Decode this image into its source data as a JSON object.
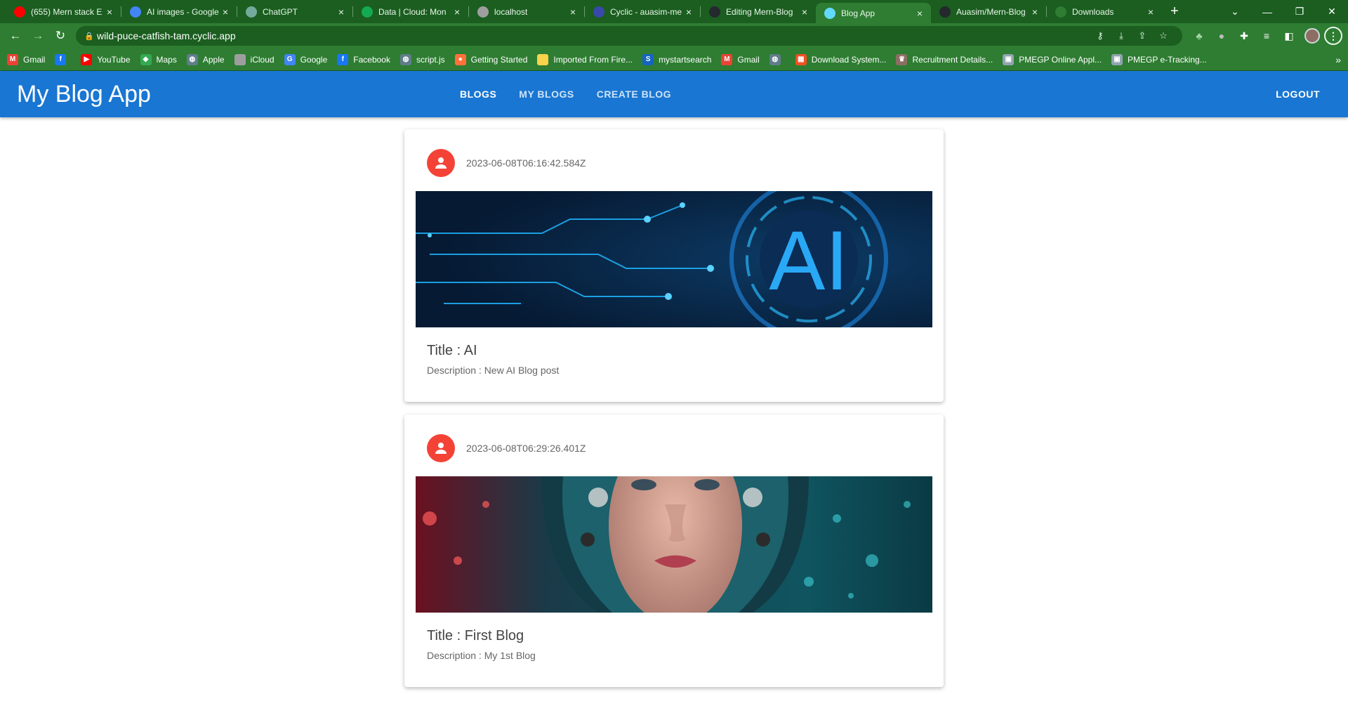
{
  "browser": {
    "tabs": [
      {
        "label": "(655) Mern stack E",
        "favicon": "youtube-icon",
        "color": "#ff0000"
      },
      {
        "label": "AI images - Google",
        "favicon": "google-icon",
        "color": "#4285f4"
      },
      {
        "label": "ChatGPT",
        "favicon": "chatgpt-icon",
        "color": "#74aa9c"
      },
      {
        "label": "Data | Cloud: Mon",
        "favicon": "mongodb-icon",
        "color": "#13aa52"
      },
      {
        "label": "localhost",
        "favicon": "globe-icon",
        "color": "#9e9e9e"
      },
      {
        "label": "Cyclic - auasim-me",
        "favicon": "cyclic-icon",
        "color": "#3949ab"
      },
      {
        "label": "Editing Mern-Blog",
        "favicon": "github-icon",
        "color": "#24292e"
      },
      {
        "label": "Blog App",
        "favicon": "react-icon",
        "color": "#61dafb",
        "active": true
      },
      {
        "label": "Auasim/Mern-Blog",
        "favicon": "github-icon",
        "color": "#24292e"
      },
      {
        "label": "Downloads",
        "favicon": "download-icon",
        "color": "#2e7d32"
      }
    ],
    "url": "wild-puce-catfish-tam.cyclic.app",
    "bookmarks": [
      {
        "label": "Gmail",
        "icon": "gmail-icon",
        "color": "#ea4335",
        "glyph": "M"
      },
      {
        "label": "",
        "icon": "facebook-icon",
        "color": "#1877f2",
        "glyph": "f"
      },
      {
        "label": "YouTube",
        "icon": "youtube-icon",
        "color": "#ff0000",
        "glyph": "▶"
      },
      {
        "label": "Maps",
        "icon": "maps-icon",
        "color": "#34a853",
        "glyph": "◆"
      },
      {
        "label": "Apple",
        "icon": "globe-icon",
        "color": "#607d8b",
        "glyph": "◍"
      },
      {
        "label": "iCloud",
        "icon": "apple-icon",
        "color": "#9e9e9e",
        "glyph": ""
      },
      {
        "label": "Google",
        "icon": "google-icon",
        "color": "#4285f4",
        "glyph": "G"
      },
      {
        "label": "Facebook",
        "icon": "facebook-icon",
        "color": "#1877f2",
        "glyph": "f"
      },
      {
        "label": "script.js",
        "icon": "globe-icon",
        "color": "#607d8b",
        "glyph": "◍"
      },
      {
        "label": "Getting Started",
        "icon": "firefox-icon",
        "color": "#ff7139",
        "glyph": "●"
      },
      {
        "label": "Imported From Fire...",
        "icon": "folder-icon",
        "color": "#f9d34b",
        "glyph": ""
      },
      {
        "label": "mystartsearch",
        "icon": "mystartsearch-icon",
        "color": "#1565c0",
        "glyph": "S"
      },
      {
        "label": "Gmail",
        "icon": "gmail-icon",
        "color": "#ea4335",
        "glyph": "M"
      },
      {
        "label": "",
        "icon": "globe-icon",
        "color": "#607d8b",
        "glyph": "◍"
      },
      {
        "label": "Download System...",
        "icon": "windows-icon",
        "color": "#f25022",
        "glyph": "▦"
      },
      {
        "label": "Recruitment Details...",
        "icon": "emblem-icon",
        "color": "#8d6e63",
        "glyph": "♛"
      },
      {
        "label": "PMEGP Online Appl...",
        "icon": "pmegp-icon",
        "color": "#90a4ae",
        "glyph": "▣"
      },
      {
        "label": "PMEGP e-Tracking...",
        "icon": "pmegp-icon",
        "color": "#90a4ae",
        "glyph": "▣"
      }
    ]
  },
  "app": {
    "brand": "My Blog App",
    "nav": [
      "BLOGS",
      "MY BLOGS",
      "CREATE BLOG"
    ],
    "logout": "LOGOUT"
  },
  "posts": [
    {
      "timestamp": "2023-06-08T06:16:42.584Z",
      "title": "Title : AI",
      "description": "Description : New AI Blog post",
      "image": "ai-circuit-banner",
      "image_text": "AI"
    },
    {
      "timestamp": "2023-06-08T06:29:26.401Z",
      "title": "Title : First Blog",
      "description": "Description : My 1st Blog",
      "image": "cyborg-woman-portrait"
    }
  ]
}
